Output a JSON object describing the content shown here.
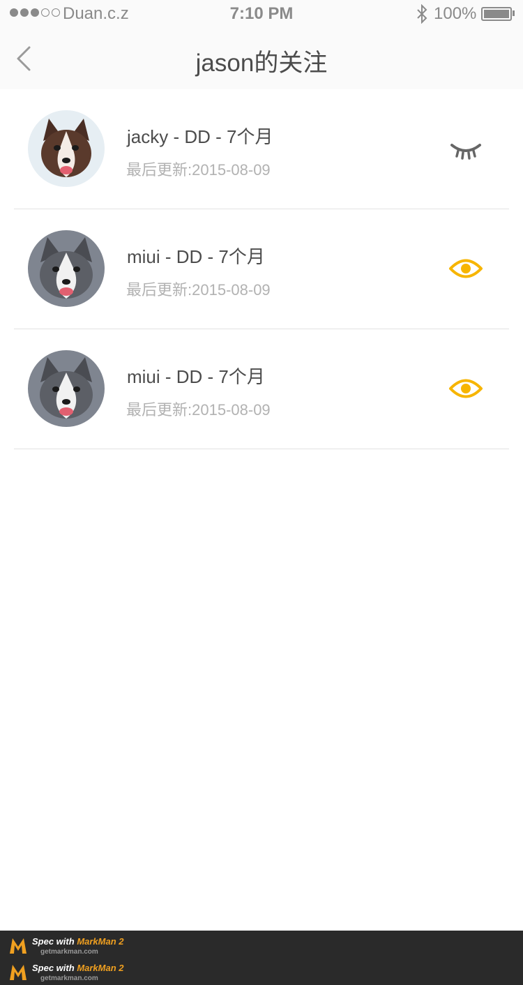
{
  "status_bar": {
    "carrier": "Duan.c.z",
    "time": "7:10 PM",
    "battery": "100%",
    "signal_bars_filled": 3,
    "signal_bars_total": 5
  },
  "nav": {
    "title": "jason的关注"
  },
  "follows": [
    {
      "name": "jacky - DD - 7个月",
      "updated_label": "最后更新:",
      "updated_date": "2015-08-09",
      "eye_state": "closed",
      "avatar": "dog-avatar-brown"
    },
    {
      "name": "miui - DD - 7个月",
      "updated_label": "最后更新:",
      "updated_date": "2015-08-09",
      "eye_state": "open",
      "avatar": "dog-avatar-grey"
    },
    {
      "name": "miui - DD - 7个月",
      "updated_label": "最后更新:",
      "updated_date": "2015-08-09",
      "eye_state": "open",
      "avatar": "dog-avatar-grey"
    }
  ],
  "footer": {
    "badges": [
      {
        "prefix": "Spec with",
        "brand": "MarkMan 2",
        "url": "getmarkman.com"
      },
      {
        "prefix": "Spec with",
        "brand": "MarkMan 2",
        "url": "getmarkman.com"
      }
    ]
  },
  "colors": {
    "nav_background": "#fafafa",
    "page_background": "#ffffff",
    "title_text": "#4c4c4c",
    "name_text": "#4c4c4c",
    "subtitle_text": "#b2b2b2",
    "eye_active": "#f7b500",
    "eye_inactive": "#666666",
    "divider": "#e2e2e2"
  }
}
